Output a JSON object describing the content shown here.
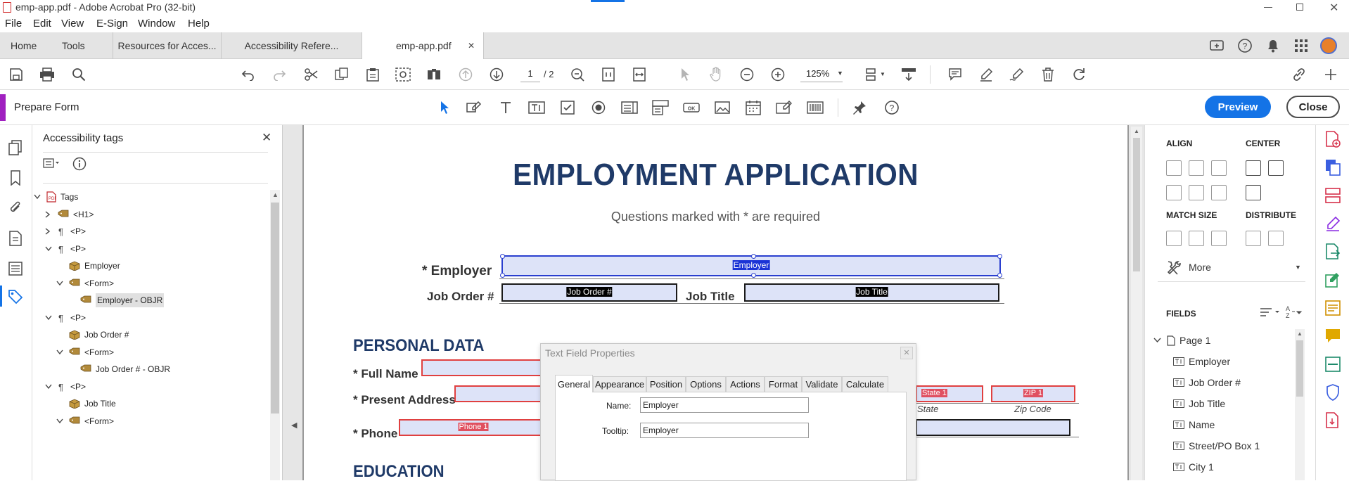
{
  "window": {
    "title": "emp-app.pdf - Adobe Acrobat Pro (32-bit)"
  },
  "menu": [
    "File",
    "Edit",
    "View",
    "E-Sign",
    "Window",
    "Help"
  ],
  "tabs": {
    "home": "Home",
    "tools": "Tools",
    "docs": [
      "Resources for Acces...",
      "Accessibility Refere...",
      "emp-app.pdf"
    ]
  },
  "toolbar": {
    "page_current": "1",
    "page_total": "/ 2",
    "zoom": "125%"
  },
  "prepare_form": {
    "title": "Prepare Form",
    "preview": "Preview",
    "close": "Close"
  },
  "tags_panel": {
    "title": "Accessibility tags",
    "tree": [
      {
        "label": "Tags",
        "type": "root"
      },
      {
        "label": "<H1>",
        "type": "tag"
      },
      {
        "label": "<P>",
        "type": "para"
      },
      {
        "label": "<P>",
        "type": "para"
      },
      {
        "label": "Employer",
        "type": "content"
      },
      {
        "label": "<Form>",
        "type": "tag"
      },
      {
        "label": "Employer - OBJR",
        "type": "objr"
      },
      {
        "label": "<P>",
        "type": "para"
      },
      {
        "label": "Job Order #",
        "type": "content"
      },
      {
        "label": "<Form>",
        "type": "tag"
      },
      {
        "label": "Job Order # - OBJR",
        "type": "objr"
      },
      {
        "label": "<P>",
        "type": "para"
      },
      {
        "label": "Job Title",
        "type": "content"
      },
      {
        "label": "<Form>",
        "type": "tag"
      }
    ]
  },
  "document": {
    "title": "EMPLOYMENT APPLICATION",
    "subtitle": "Questions marked with * are required",
    "employer_label": "* Employer",
    "employer_field": "Employer",
    "job_order_label": "Job Order #",
    "job_order_field": "Job Order #",
    "job_title_label": "Job Title",
    "job_title_field": "Job Title",
    "section_personal": "PERSONAL DATA",
    "full_name_label": "* Full Name",
    "address_label": "* Present Address",
    "phone_label": "* Phone",
    "phone_field": "Phone 1",
    "state_field": "State 1",
    "zip_field": "ZIP 1",
    "state_caption": "State",
    "zip_caption": "Zip Code",
    "section_education": "EDUCATION"
  },
  "dialog": {
    "title": "Text Field Properties",
    "tabs": [
      "General",
      "Appearance",
      "Position",
      "Options",
      "Actions",
      "Format",
      "Validate",
      "Calculate"
    ],
    "name_label": "Name:",
    "name_value": "Employer",
    "tooltip_label": "Tooltip:",
    "tooltip_value": "Employer"
  },
  "right_panel": {
    "align": "ALIGN",
    "center": "CENTER",
    "match_size": "MATCH SIZE",
    "distribute": "DISTRIBUTE",
    "more": "More",
    "fields_header": "FIELDS",
    "fields": [
      "Page 1",
      "Employer",
      "Job Order #",
      "Job Title",
      "Name",
      "Street/PO Box 1",
      "City 1"
    ]
  },
  "colors": {
    "accent": "#1473e6",
    "doc_title": "#1f3a68",
    "form_accent": "#a020c0"
  }
}
